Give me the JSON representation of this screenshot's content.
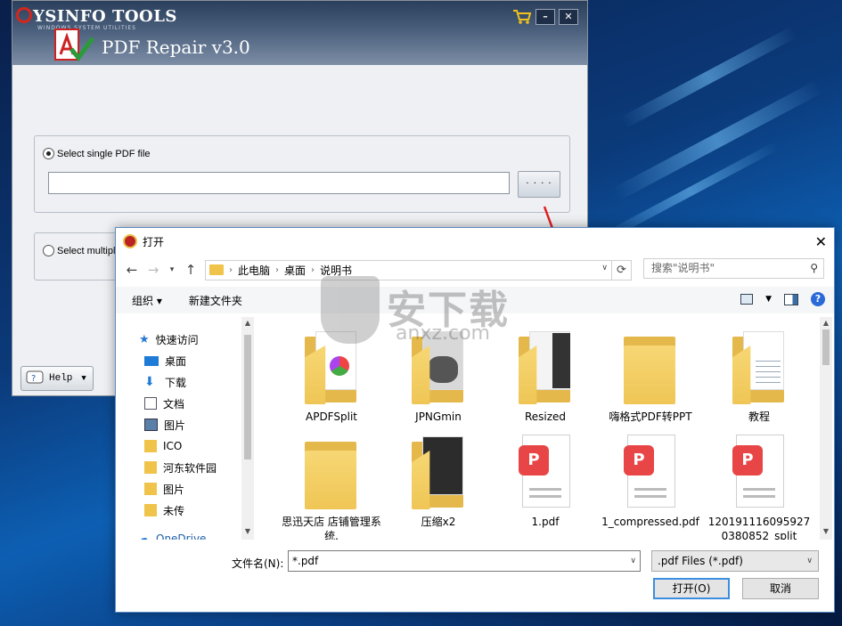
{
  "app": {
    "brand": "YSINFO TOOLS",
    "brand_tagline": "WINDOWS SYSTEM UTILITIES",
    "title": "PDF Repair v3.0",
    "option_single": "Select single PDF file",
    "option_multiple": "Select multiple",
    "browse_label": "· · · ·",
    "help_label": "Help",
    "minimize_label": "–",
    "close_label": "✕"
  },
  "dialog": {
    "title": "打开",
    "close_label": "✕",
    "breadcrumb": [
      "此电脑",
      "桌面",
      "说明书"
    ],
    "search_placeholder": "搜索\"说明书\"",
    "organize_label": "组织 ▾",
    "new_folder_label": "新建文件夹",
    "sidebar": [
      {
        "label": "快速访问",
        "icon": "star-icon"
      },
      {
        "label": "桌面",
        "icon": "desktop-icon",
        "pinned": true
      },
      {
        "label": "下载",
        "icon": "download-icon",
        "pinned": true
      },
      {
        "label": "文档",
        "icon": "document-icon",
        "pinned": true
      },
      {
        "label": "图片",
        "icon": "picture-icon",
        "pinned": true
      },
      {
        "label": "ICO",
        "icon": "folder-icon"
      },
      {
        "label": "河东软件园",
        "icon": "folder-icon"
      },
      {
        "label": "图片",
        "icon": "folder-icon"
      },
      {
        "label": "未传",
        "icon": "folder-icon"
      },
      {
        "label": "OneDrive",
        "icon": "cloud-icon"
      }
    ],
    "files": [
      {
        "name": "APDFSplit",
        "kind": "folder"
      },
      {
        "name": "JPNGmin",
        "kind": "folder"
      },
      {
        "name": "Resized",
        "kind": "folder"
      },
      {
        "name": "嗨格式PDF转PPT",
        "kind": "folder"
      },
      {
        "name": "教程",
        "kind": "folder"
      },
      {
        "name": "思迅天店 店铺管理系统.",
        "kind": "folder"
      },
      {
        "name": "压缩x2",
        "kind": "folder"
      },
      {
        "name": "1.pdf",
        "kind": "pdf"
      },
      {
        "name": "1_compressed.pdf",
        "kind": "pdf"
      },
      {
        "name": "1201911160959270380852_split",
        "kind": "pdf"
      }
    ],
    "filename_label": "文件名(N):",
    "filename_value": "*.pdf",
    "filetype_value": ".pdf Files (*.pdf)",
    "open_label": "打开(O)",
    "cancel_label": "取消"
  },
  "watermark": {
    "text": "安下载",
    "sub": "anxz.com"
  },
  "colors": {
    "accent": "#3d8ee0",
    "pdf_red": "#e84646",
    "folder": "#f0c44a",
    "header": "#3a4f6c"
  }
}
